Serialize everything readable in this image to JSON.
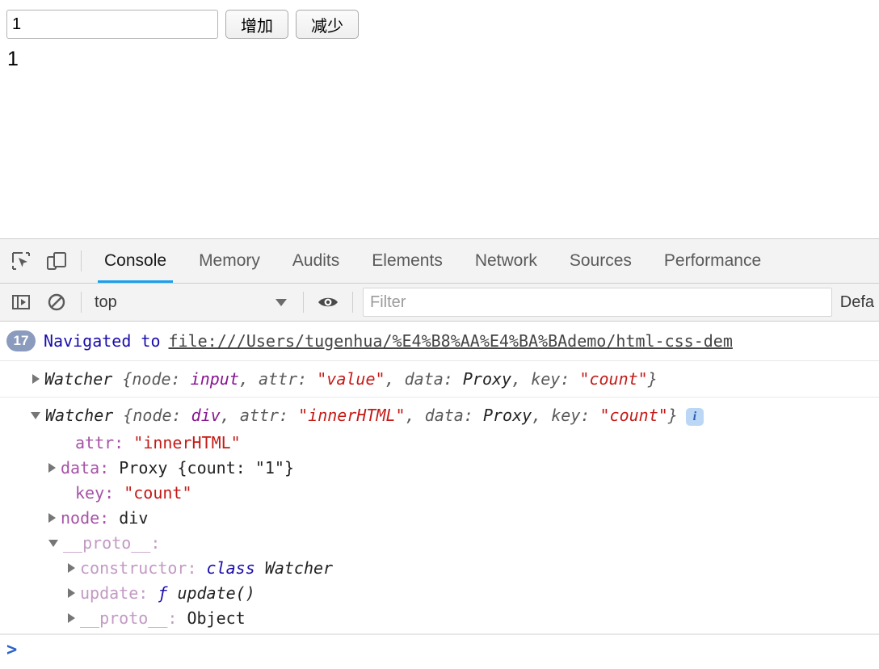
{
  "page": {
    "input_value": "1",
    "input_placeholder": "",
    "increase_label": "增加",
    "decrease_label": "减少",
    "count_display": "1"
  },
  "devtools": {
    "icons": {
      "inspect": "inspect-element-icon",
      "device": "device-toolbar-icon",
      "sidebar": "console-sidebar-icon",
      "clear": "clear-console-icon",
      "eye": "live-expression-eye-icon",
      "caret": "chevron-down-icon"
    },
    "tabs": [
      {
        "label": "Console",
        "active": true
      },
      {
        "label": "Memory",
        "active": false
      },
      {
        "label": "Audits",
        "active": false
      },
      {
        "label": "Elements",
        "active": false
      },
      {
        "label": "Network",
        "active": false
      },
      {
        "label": "Sources",
        "active": false
      },
      {
        "label": "Performance",
        "active": false
      }
    ],
    "filterbar": {
      "context": "top",
      "filter_placeholder": "Filter",
      "filter_value": "",
      "levels": "Defa"
    },
    "console": {
      "navigated": {
        "badge": "17",
        "text": "Navigated to",
        "url": "file:///Users/tugenhua/%E4%B8%AA%E4%BA%BAdemo/html-css-dem"
      },
      "entry1": {
        "class": "Watcher",
        "open_brace": " {",
        "k_node": "node:",
        "v_node": "input",
        "sep1": ", ",
        "k_attr": "attr:",
        "v_attr": "\"value\"",
        "sep2": ", ",
        "k_data": "data:",
        "v_data": "Proxy",
        "sep3": ", ",
        "k_key": "key:",
        "v_key": "\"count\"",
        "close_brace": "}"
      },
      "entry2": {
        "class": "Watcher",
        "open_brace": " {",
        "k_node": "node:",
        "v_node": "div",
        "sep1": ", ",
        "k_attr": "attr:",
        "v_attr": "\"innerHTML\"",
        "sep2": ", ",
        "k_data": "data:",
        "v_data": "Proxy",
        "sep3": ", ",
        "k_key": "key:",
        "v_key": "\"count\"",
        "close_brace": "}",
        "info_badge": "i"
      },
      "properties": [
        {
          "name": "attr:",
          "value": "\"innerHTML\""
        },
        {
          "name": "data:",
          "value": "Proxy {count: \"1\"}"
        },
        {
          "name": "key:",
          "value": "\"count\""
        },
        {
          "name": "node:",
          "value": "div"
        },
        {
          "name": "__proto__:",
          "value": ""
        }
      ],
      "proto_children": [
        {
          "name": "constructor:",
          "keyword": "class",
          "value": "Watcher"
        },
        {
          "name": "update:",
          "keyword": "ƒ",
          "value": "update()"
        },
        {
          "name": "__proto__:",
          "keyword": "",
          "value": "Object"
        }
      ],
      "prompt": {
        "chevron": ">",
        "value": "",
        "placeholder": ""
      }
    }
  }
}
